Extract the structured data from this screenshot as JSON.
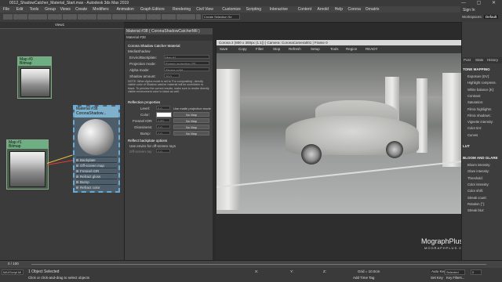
{
  "window": {
    "title": "0012_ShadowCatcher_Material_Start.max - Autodesk 3ds Max 2019"
  },
  "menu": [
    "File",
    "Edit",
    "Tools",
    "Group",
    "Views",
    "Create",
    "Modifiers",
    "Animation",
    "Graph Editors",
    "Rendering",
    "Civil View",
    "Customize",
    "Scripting",
    "Interactive",
    "Content",
    "Arnold",
    "Help",
    "Corona",
    "Ornatrix"
  ],
  "toolbar": {
    "selection_set": "Create Selection Se",
    "sign_in": "Sign In",
    "workspaces": "Workspaces:",
    "workspace_value": "Default"
  },
  "node_editor": {
    "tab": "View1",
    "nodes": [
      {
        "title": "Map #0",
        "subtitle": "Bitmap"
      },
      {
        "title": "Map #1",
        "subtitle": "Bitmap"
      }
    ],
    "material": {
      "title": "Material #38",
      "subtitle": "CoronaShadow...",
      "slots": [
        "Backplate",
        "Off-screen map",
        "Fresnel IOR",
        "Refract gloss",
        "Bump",
        "Refract color"
      ]
    }
  },
  "properties": {
    "header": "Material #38 ( CoronaShadowCatcherMtl )",
    "subheader": "Material #38",
    "rollout_title": "Corona Shadow Catcher Material",
    "rollout_sub": "MediaShadow",
    "envio_label": "Enviro/Backplate:",
    "envio_value": "Map #1 (plush_garage_map.jpg)",
    "projection_label": "Projection mode:",
    "projection_value": "Screen projection (2D backplate)",
    "alpha_label": "Alpha mode:",
    "alpha_value": "Always solid",
    "shadow_label": "Shadow amount:",
    "shadow_value": "10.0",
    "note": "NOTE: When Alpha mode is set to 'For compositing', directly visible color of Shadow catcher material will be overridden to black. To preview the correct results, make sure to render directly visible environment color to black as well.",
    "reflection_title": "Reflection properties",
    "level_label": "Level:",
    "level_value": "0.0",
    "use_matte": "Use matte projection mode",
    "color_label": "Color:",
    "fresnel_label": "Fresnel IOR:",
    "fresnel_value": "1.52",
    "gloss_label": "Glossiness:",
    "gloss_value": "1.0",
    "bump_label": "Bump:",
    "bump_value": "1.0",
    "no_map": "No Map",
    "backplate_title": "Reflect backplate options",
    "use_env": "Use enviro for off-screen rays",
    "screen_ray": "Off-screen ray",
    "screen_value": "1.0"
  },
  "render_window": {
    "title": "Corona 2 (800 x 300px (1:1)) | Camera: CoronaCamera001 | Frame 0",
    "toolbar": [
      "Save",
      "Copy",
      "Filter",
      "Stop",
      "Refresh",
      "Setup",
      "Tools",
      "Region",
      "READY"
    ]
  },
  "right_panel": {
    "tabs": [
      "Post",
      "Stats",
      "History"
    ],
    "sections": [
      {
        "title": "TONE MAPPING",
        "items": [
          "Exposure (EV):",
          "Highlight compress.",
          "White balance [K]:",
          "Contrast:",
          "Saturation:",
          "Filmic highlights:",
          "Filmic shadows:",
          "Vignette intensity:",
          "Color tint:",
          "Curves"
        ]
      },
      {
        "title": "LUT",
        "items": []
      },
      {
        "title": "BLOOM AND GLARE",
        "items": [
          "Bloom intensity:",
          "Glare intensity:",
          "Threshold:",
          "Color intensity:",
          "Color shift:",
          "Streak count:",
          "Rotation [°]:",
          "Streak blur:"
        ]
      }
    ]
  },
  "watermark": {
    "main": "MographPlus",
    "sub": "MOGRAPHPLUS.COM"
  },
  "timeline": {
    "frame": "0 / 100"
  },
  "status": {
    "selected": "1 Object Selected",
    "hint": "Click or click-and-drag to select objects",
    "script": "MAXScript Mi",
    "auto_key": "Auto Key",
    "set_key": "Set Key",
    "selected_dd": "Selected",
    "key_filters": "Key Filters...",
    "add_time_tag": "Add Time Tag",
    "grid": "Grid = 10.0cm",
    "x_label": "X:",
    "y_label": "Y:",
    "z_label": "Z:",
    "frame_num": "0"
  }
}
